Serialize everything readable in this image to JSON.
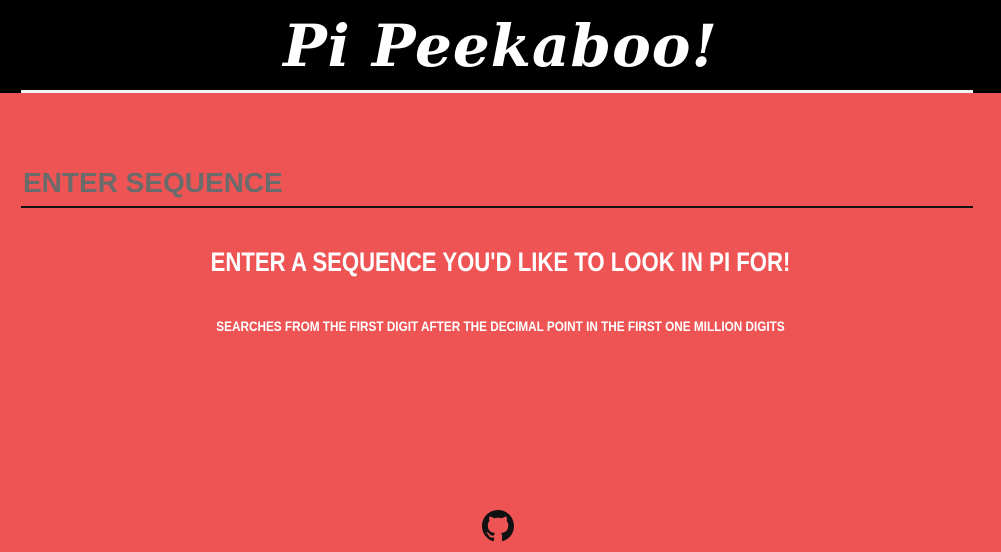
{
  "header": {
    "title": "Pi Peekaboo!"
  },
  "search": {
    "placeholder": "ENTER SEQUENCE",
    "value": ""
  },
  "main": {
    "prompt": "ENTER A SEQUENCE YOU'D LIKE TO LOOK IN PI FOR!",
    "subtext": "SEARCHES FROM THE FIRST DIGIT AFTER THE DECIMAL POINT IN THE FIRST ONE MILLION DIGITS"
  },
  "footer": {
    "icon": "github-icon"
  },
  "colors": {
    "background": "#ef5455",
    "header": "#000000",
    "text": "#ffffff"
  }
}
